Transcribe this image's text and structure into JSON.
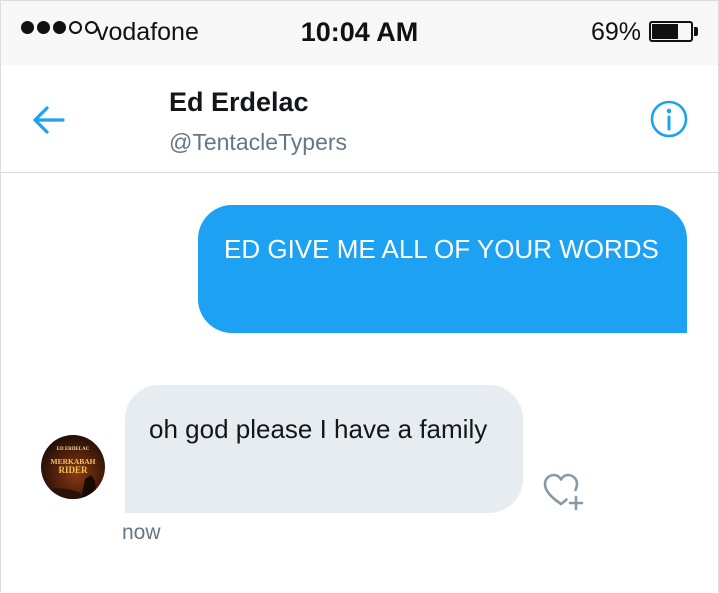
{
  "status_bar": {
    "signal_strength": 3,
    "signal_total": 5,
    "carrier": "vodafone",
    "time": "10:04 AM",
    "battery_text": "69%",
    "battery_level": 0.69
  },
  "header": {
    "back_icon": "arrow-left-icon",
    "name": "Ed Erdelac",
    "handle": "@TentacleTypers",
    "info_icon": "info-icon"
  },
  "messages": [
    {
      "direction": "sent",
      "text": "ED GIVE ME ALL OF YOUR WORDS"
    },
    {
      "direction": "received",
      "text": "oh god please I have a family",
      "time": "now"
    }
  ],
  "avatar": {
    "lines": [
      "ED ERDELAC",
      "MERKABAH",
      "RIDER"
    ]
  },
  "like_icon": "heart-plus-icon",
  "colors": {
    "accent": "#1da1f2",
    "received_bubble": "#e6ecf0",
    "secondary_text": "#657786"
  }
}
